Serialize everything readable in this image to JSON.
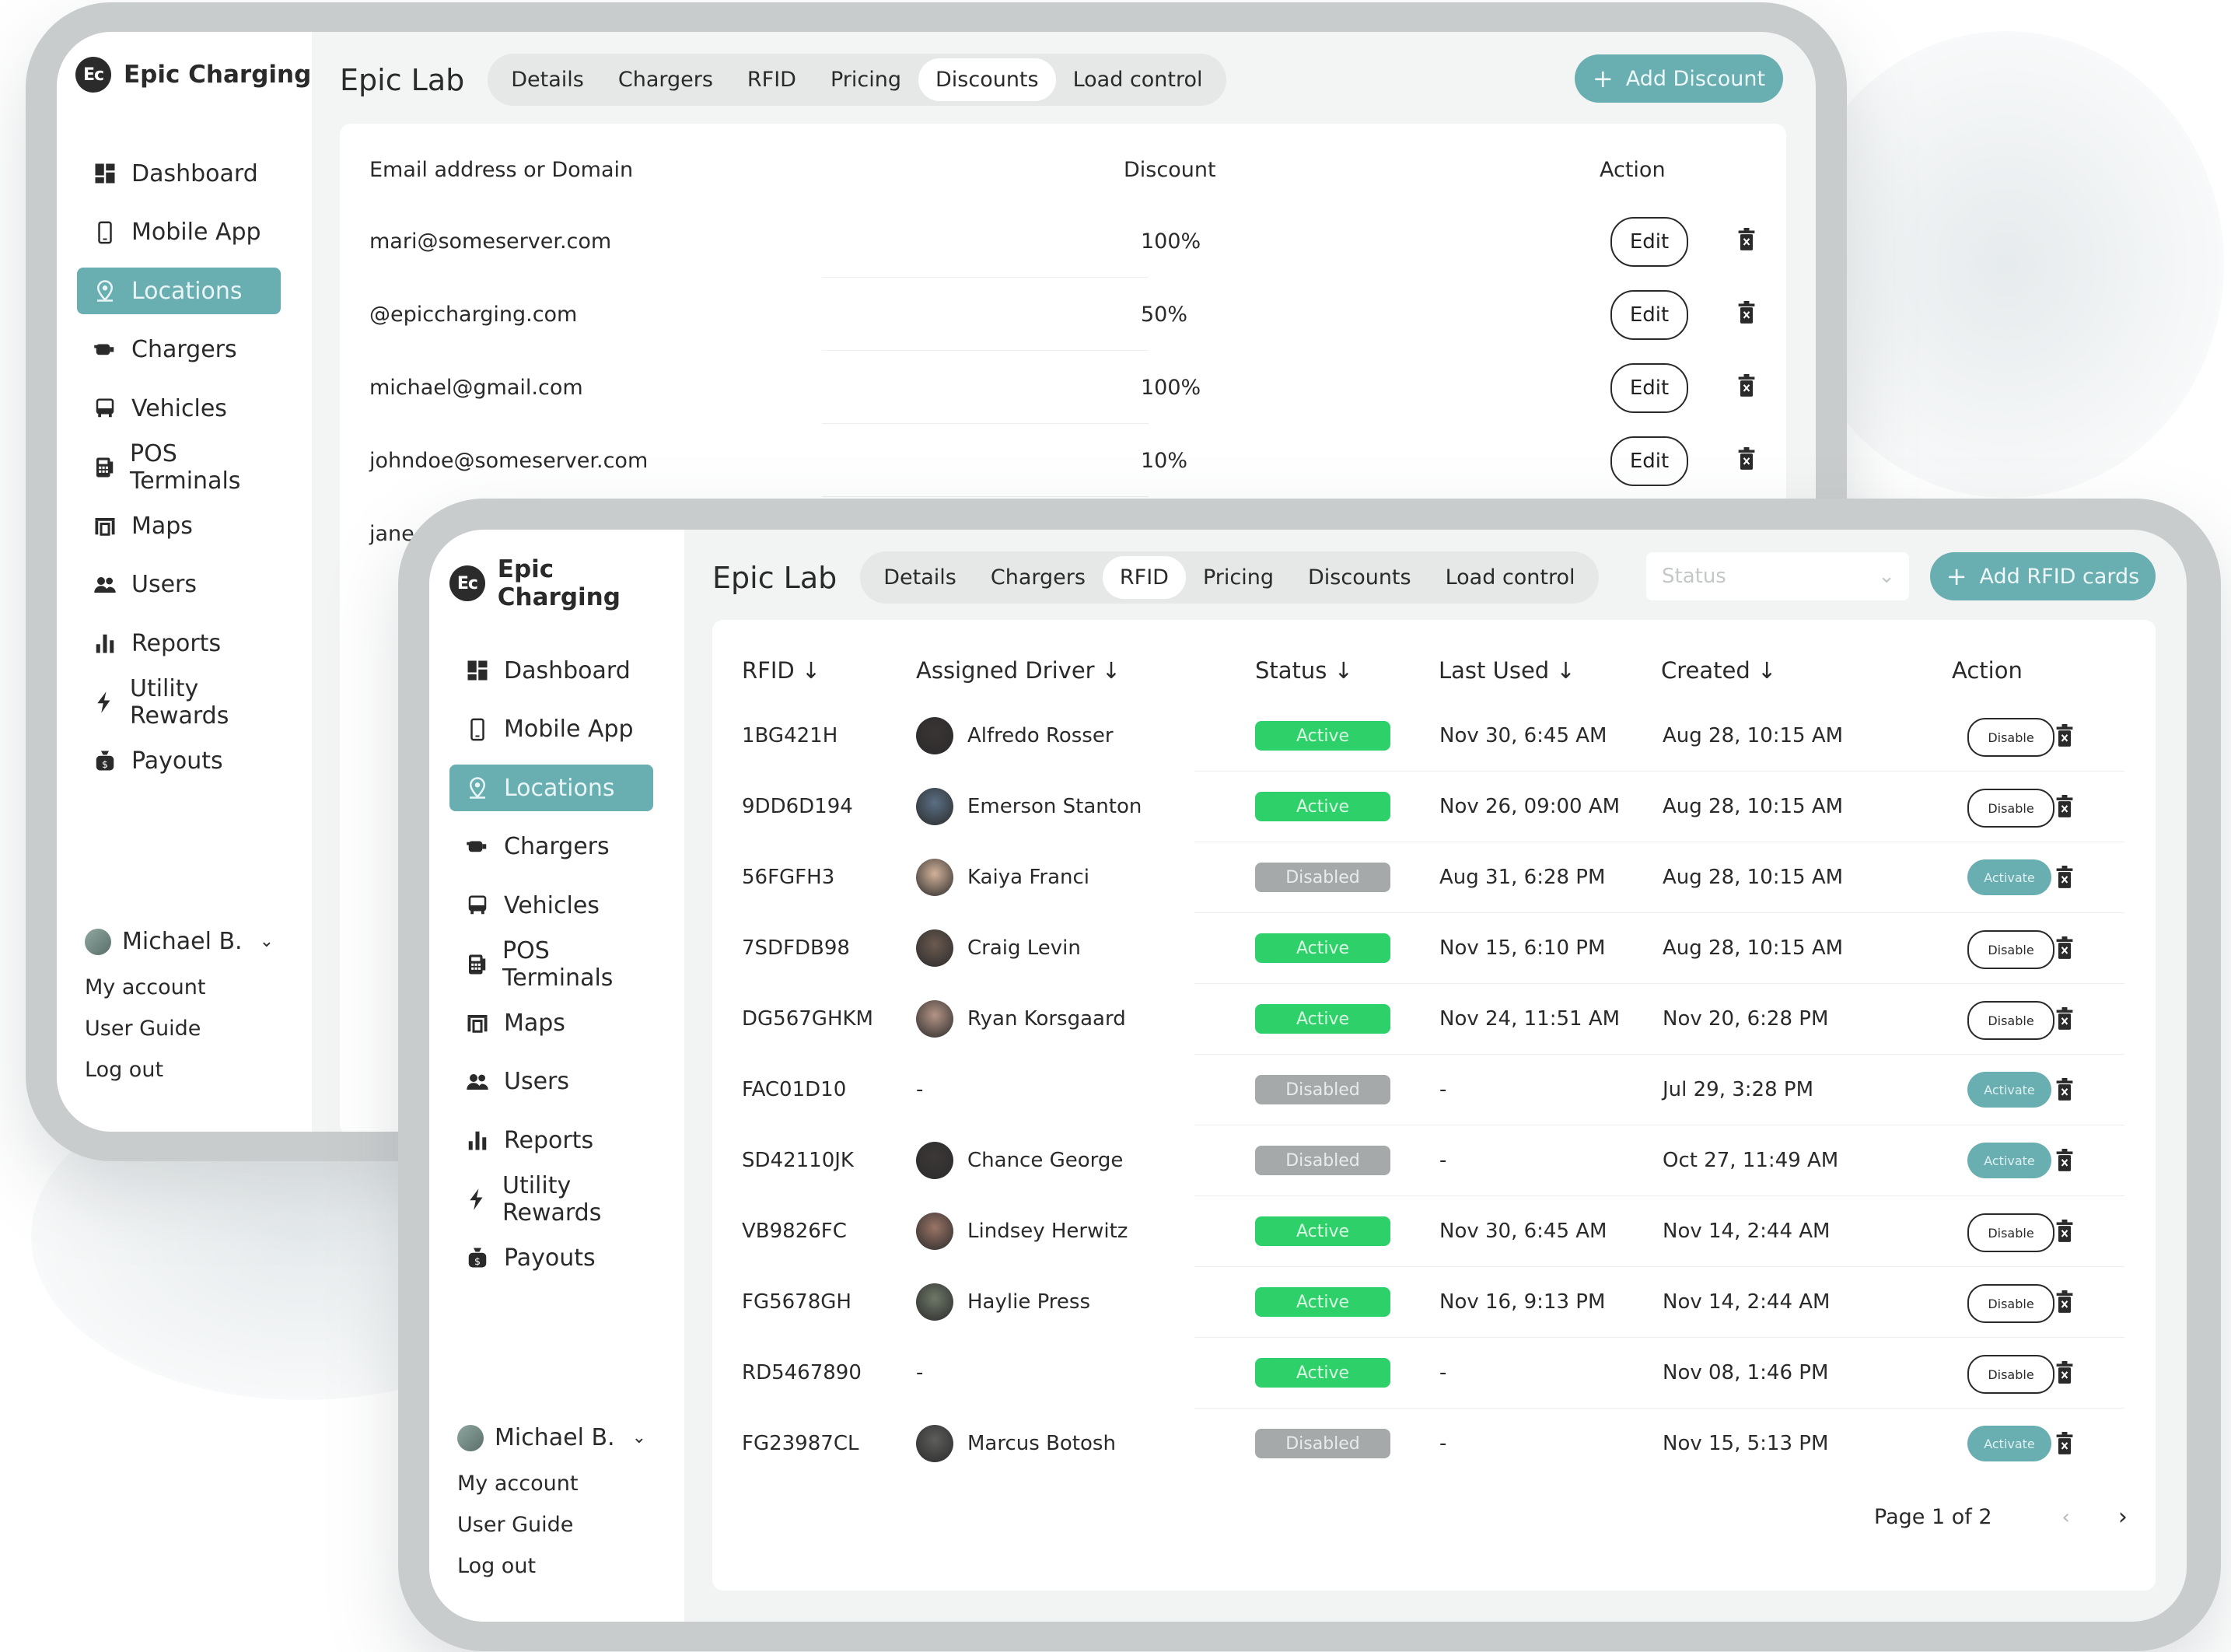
{
  "colors": {
    "accent": "#69aeb1",
    "active_status": "#2ed06a",
    "disabled_status": "#a5a9aa",
    "frame": "#c9cccd"
  },
  "sidebar": {
    "brand_logo": "Ec",
    "brand_name": "Epic Charging",
    "items": [
      {
        "label": "Dashboard",
        "icon": "dashboard-icon"
      },
      {
        "label": "Mobile App",
        "icon": "phone-icon"
      },
      {
        "label": "Locations",
        "icon": "location-icon"
      },
      {
        "label": "Chargers",
        "icon": "charger-icon"
      },
      {
        "label": "Vehicles",
        "icon": "vehicle-icon"
      },
      {
        "label": "POS Terminals",
        "icon": "pos-terminal-icon"
      },
      {
        "label": "Maps",
        "icon": "map-icon"
      },
      {
        "label": "Users",
        "icon": "users-icon"
      },
      {
        "label": "Reports",
        "icon": "reports-icon"
      },
      {
        "label": "Utility Rewards",
        "icon": "lightning-icon"
      },
      {
        "label": "Payouts",
        "icon": "payouts-icon"
      }
    ],
    "active_item": "Locations",
    "user_name": "Michael B.",
    "user_links": [
      "My account",
      "User Guide",
      "Log out"
    ]
  },
  "back_window": {
    "title": "Epic Lab",
    "tabs": [
      "Details",
      "Chargers",
      "RFID",
      "Pricing",
      "Discounts",
      "Load control"
    ],
    "active_tab": "Discounts",
    "add_button": "Add Discount",
    "columns": [
      "Email address or Domain",
      "Discount",
      "Action"
    ],
    "edit_label": "Edit",
    "rows": [
      {
        "email": "mari@someserver.com",
        "discount": "100%"
      },
      {
        "email": "@epiccharging.com",
        "discount": "50%"
      },
      {
        "email": "michael@gmail.com",
        "discount": "100%"
      },
      {
        "email": "johndoe@someserver.com",
        "discount": "10%"
      },
      {
        "email": "jane",
        "discount": ""
      }
    ]
  },
  "front_window": {
    "title": "Epic Lab",
    "tabs": [
      "Details",
      "Chargers",
      "RFID",
      "Pricing",
      "Discounts",
      "Load control"
    ],
    "active_tab": "RFID",
    "status_placeholder": "Status",
    "add_button": "Add RFID cards",
    "columns": [
      "RFID ↓",
      "Assigned Driver ↓",
      "Status ↓",
      "Last Used ↓",
      "Created ↓",
      "Action"
    ],
    "rows": [
      {
        "rfid": "1BG421H",
        "driver": "Alfredo Rosser",
        "status": "Active",
        "last_used": "Nov 30,  6:45 AM",
        "created": "Aug 28, 10:15 AM",
        "action": "Disable"
      },
      {
        "rfid": "9DD6D194",
        "driver": "Emerson Stanton",
        "status": "Active",
        "last_used": "Nov 26,  09:00 AM",
        "created": "Aug 28, 10:15 AM",
        "action": "Disable"
      },
      {
        "rfid": "56FGFH3",
        "driver": "Kaiya Franci",
        "status": "Disabled",
        "last_used": "Aug 31,  6:28 PM",
        "created": "Aug 28, 10:15 AM",
        "action": "Activate"
      },
      {
        "rfid": "7SDFDB98",
        "driver": "Craig Levin",
        "status": "Active",
        "last_used": "Nov 15,  6:10 PM",
        "created": "Aug 28, 10:15 AM",
        "action": "Disable"
      },
      {
        "rfid": "DG567GHKM",
        "driver": "Ryan Korsgaard",
        "status": "Active",
        "last_used": "Nov 24,  11:51 AM",
        "created": "Nov 20,  6:28 PM",
        "action": "Disable"
      },
      {
        "rfid": "FAC01D10",
        "driver": "-",
        "status": "Disabled",
        "last_used": "-",
        "created": "Jul 29,  3:28 PM",
        "action": "Activate"
      },
      {
        "rfid": "SD42110JK",
        "driver": "Chance George",
        "status": "Disabled",
        "last_used": "-",
        "created": "Oct 27, 11:49 AM",
        "action": "Activate"
      },
      {
        "rfid": "VB9826FC",
        "driver": "Lindsey Herwitz",
        "status": "Active",
        "last_used": "Nov 30,  6:45 AM",
        "created": "Nov 14, 2:44 AM",
        "action": "Disable"
      },
      {
        "rfid": "FG5678GH",
        "driver": "Haylie Press",
        "status": "Active",
        "last_used": "Nov 16,  9:13 PM",
        "created": "Nov 14, 2:44 AM",
        "action": "Disable"
      },
      {
        "rfid": "RD5467890",
        "driver": "-",
        "status": "Active",
        "last_used": "-",
        "created": "Nov 08, 1:46 PM",
        "action": "Disable"
      },
      {
        "rfid": "FG23987CL",
        "driver": "Marcus Botosh",
        "status": "Disabled",
        "last_used": "-",
        "created": "Nov 15,  5:13 PM",
        "action": "Activate"
      }
    ],
    "pagination": "Page 1 of 2",
    "prev_icon": "chevron-left-icon",
    "next_icon": "chevron-right-icon"
  }
}
